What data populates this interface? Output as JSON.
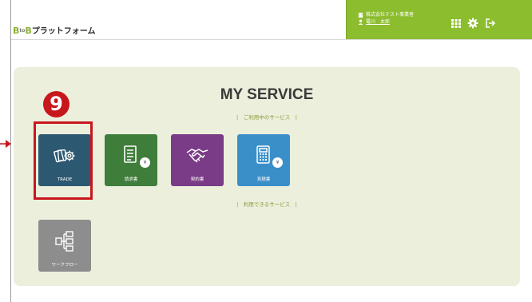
{
  "header": {
    "logo_b1": "B",
    "logo_mid": "to",
    "logo_b2": "B",
    "logo_text": "プラットフォーム",
    "company_name": "株式会社テスト事業者",
    "user_name": "電川　太郎"
  },
  "main": {
    "title": "MY SERVICE",
    "in_use_label": "|　ご利用中のサービス　|",
    "available_label": "|　利用できるサービス　|",
    "in_use_services": [
      {
        "label": "TRADE",
        "icon": "trade-gears-icon",
        "color": "#2c5872"
      },
      {
        "label": "請求書",
        "icon": "invoice-document-icon",
        "color": "#3f7d3a"
      },
      {
        "label": "契約書",
        "icon": "handshake-icon",
        "color": "#7a3b87"
      },
      {
        "label": "見積書",
        "icon": "calculator-icon",
        "color": "#3a8fc9"
      }
    ],
    "available_services": [
      {
        "label": "ワークフロー",
        "icon": "workflow-hierarchy-icon",
        "color": "#8d8d8d"
      }
    ],
    "yen_symbol": "¥"
  },
  "annotation": {
    "step_number": "9",
    "color": "#c8161d"
  },
  "colors": {
    "header_green": "#8cbd2e",
    "panel_bg": "#ecefdc"
  }
}
